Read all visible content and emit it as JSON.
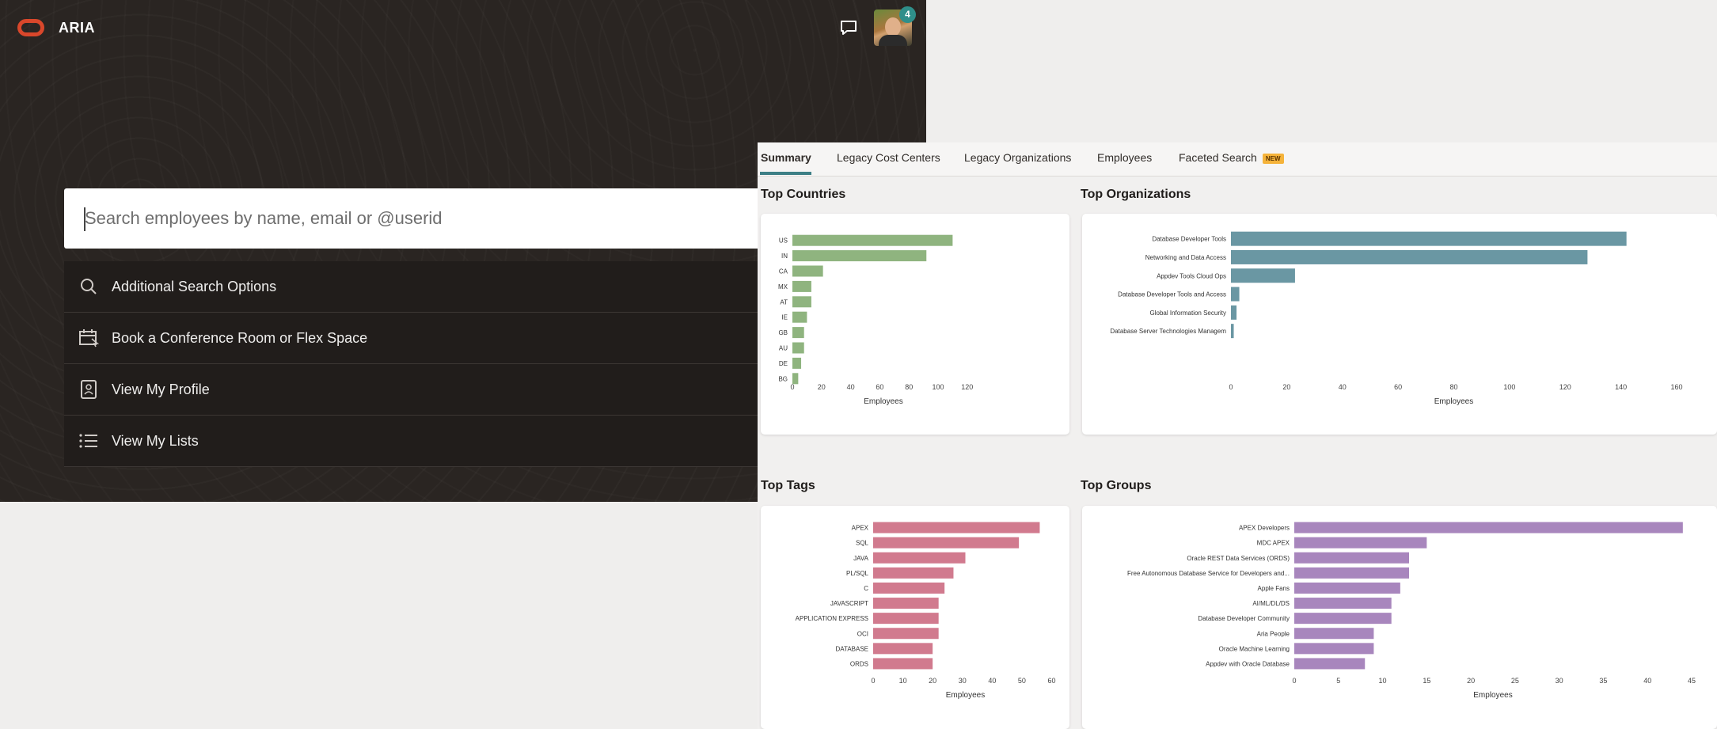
{
  "app": {
    "title": "ARIA",
    "notification_count": "4"
  },
  "search": {
    "placeholder": "Search employees by name, email or @userid"
  },
  "menu": {
    "items": [
      {
        "label": "Additional Search Options",
        "icon": "search-icon"
      },
      {
        "label": "Book a Conference Room or Flex Space",
        "icon": "calendar-icon"
      },
      {
        "label": "View My Profile",
        "icon": "profile-icon"
      },
      {
        "label": "View My Lists",
        "icon": "list-icon"
      }
    ]
  },
  "tabs": [
    {
      "label": "Summary",
      "active": true
    },
    {
      "label": "Legacy Cost Centers"
    },
    {
      "label": "Legacy Organizations"
    },
    {
      "label": "Employees"
    },
    {
      "label": "Faceted Search",
      "badge": "NEW"
    }
  ],
  "sections": {
    "top_countries": "Top Countries",
    "top_organizations": "Top Organizations",
    "top_tags": "Top Tags",
    "top_groups": "Top Groups"
  },
  "colors": {
    "countries": "#8fb47f",
    "organizations": "#6a97a3",
    "tags": "#d17a8e",
    "groups": "#a886bd",
    "brand": "#d9472b"
  },
  "chart_data": [
    {
      "id": "countries",
      "type": "bar",
      "orientation": "horizontal",
      "categories": [
        "US",
        "IN",
        "CA",
        "MX",
        "AT",
        "IE",
        "GB",
        "AU",
        "DE",
        "BG"
      ],
      "values": [
        110,
        92,
        21,
        13,
        13,
        10,
        8,
        8,
        6,
        4
      ],
      "xlabel": "Employees",
      "xlim": [
        0,
        125
      ],
      "xticks": [
        0,
        20,
        40,
        60,
        80,
        100,
        120
      ]
    },
    {
      "id": "organizations",
      "type": "bar",
      "orientation": "horizontal",
      "categories": [
        "Database Developer Tools",
        "Networking and Data Access",
        "Appdev Tools Cloud Ops",
        "Database Developer Tools and Access",
        "Global Information Security",
        "Database Server Technologies Managem"
      ],
      "values": [
        142,
        128,
        23,
        3,
        2,
        1
      ],
      "xlabel": "Employees",
      "xlim": [
        0,
        160
      ],
      "xticks": [
        0,
        20,
        40,
        60,
        80,
        100,
        120,
        140,
        160
      ]
    },
    {
      "id": "tags",
      "type": "bar",
      "orientation": "horizontal",
      "categories": [
        "APEX",
        "SQL",
        "JAVA",
        "PL/SQL",
        "C",
        "JAVASCRIPT",
        "APPLICATION EXPRESS",
        "OCI",
        "DATABASE",
        "ORDS"
      ],
      "values": [
        56,
        49,
        31,
        27,
        24,
        22,
        22,
        22,
        20,
        20
      ],
      "xlabel": "Employees",
      "xlim": [
        0,
        62
      ],
      "xticks": [
        0,
        10,
        20,
        30,
        40,
        50,
        60
      ]
    },
    {
      "id": "groups",
      "type": "bar",
      "orientation": "horizontal",
      "categories": [
        "APEX Developers",
        "MDC APEX",
        "Oracle REST Data Services (ORDS)",
        "Free Autonomous Database Service for Developers and...",
        "Apple Fans",
        "AI/ML/DL/DS",
        "Database Developer Community",
        "Aria People",
        "Oracle Machine Learning",
        "Appdev with Oracle Database"
      ],
      "values": [
        44,
        15,
        13,
        13,
        12,
        11,
        11,
        9,
        9,
        8
      ],
      "xlabel": "Employees",
      "xlim": [
        0,
        45
      ],
      "xticks": [
        0,
        5,
        10,
        15,
        20,
        25,
        30,
        35,
        40,
        45
      ]
    }
  ]
}
